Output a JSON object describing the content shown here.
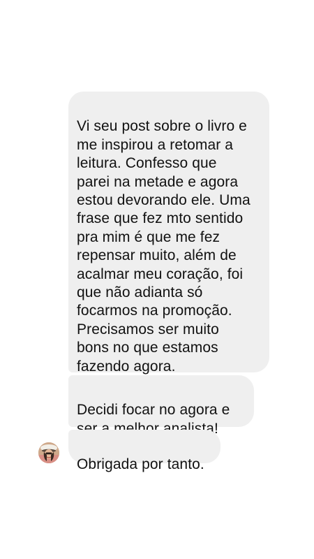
{
  "messages": [
    {
      "text": "Vi seu post sobre o livro e\nme inspirou a retomar a\nleitura. Confesso que\nparei na metade e agora\nestou devorando ele. Uma\nfrase que fez mto sentido\npra mim é que me fez\nrepensar muito, além de\nacalmar meu coração, foi\nque não adianta só\nfocarmos na promoção.\nPrecisamos ser muito\nbons no que estamos\nfazendo agora."
    },
    {
      "text": "Decidi focar no agora e\nser a melhor analista!",
      "emoji": "❤️"
    },
    {
      "text": "Obrigada por tanto."
    }
  ],
  "colors": {
    "bubble": "#efefef",
    "text": "#111111",
    "heart": "#e0182d"
  },
  "avatar": {
    "icon": "user-avatar-photo"
  }
}
